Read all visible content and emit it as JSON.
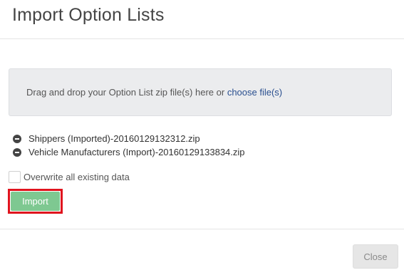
{
  "dialog": {
    "title": "Import Option Lists"
  },
  "dropzone": {
    "text": "Drag and drop your Option List zip file(s) here or ",
    "link_label": "choose file(s)"
  },
  "files": [
    {
      "name": "Shippers (Imported)-20160129132312.zip",
      "icon": "minus-circle-icon"
    },
    {
      "name": "Vehicle Manufacturers (Import)-20160129133834.zip",
      "icon": "minus-circle-icon"
    }
  ],
  "options": {
    "overwrite_label": "Overwrite all existing data",
    "overwrite_checked": false
  },
  "actions": {
    "import_label": "Import",
    "close_label": "Close"
  },
  "colors": {
    "import_button": "#7ec891",
    "highlight_border": "#e0141e",
    "link": "#2a4f8f"
  }
}
